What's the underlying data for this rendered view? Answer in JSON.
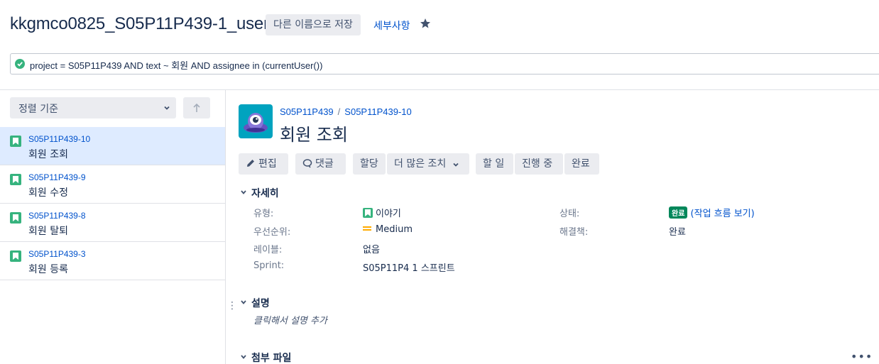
{
  "header": {
    "filter_title": "kkgmco0825_S05P11P439-1_user",
    "save_as_label": "다른 이름으로 저장",
    "details_label": "세부사항"
  },
  "jql": {
    "query": "project = S05P11P439 AND text ~ 회원 AND assignee in (currentUser())"
  },
  "sidebar": {
    "sort_label": "정렬 기준",
    "issues": [
      {
        "key": "S05P11P439-10",
        "summary": "회원 조회",
        "selected": true
      },
      {
        "key": "S05P11P439-9",
        "summary": "회원 수정",
        "selected": false
      },
      {
        "key": "S05P11P439-8",
        "summary": "회원 탈퇴",
        "selected": false
      },
      {
        "key": "S05P11P439-3",
        "summary": "회원 등록",
        "selected": false
      }
    ]
  },
  "issue": {
    "project_key": "S05P11P439",
    "issue_key": "S05P11P439-10",
    "title": "회원 조회",
    "toolbar": {
      "edit": "편집",
      "comment": "댓글",
      "assign": "할당",
      "more": "더 많은 조치",
      "todo": "할 일",
      "in_progress": "진행 중",
      "done": "완료"
    },
    "details": {
      "heading": "자세히",
      "type_label": "유형:",
      "type_value": "이야기",
      "priority_label": "우선순위:",
      "priority_value": "Medium",
      "labels_label": "레이블:",
      "labels_value": "없음",
      "sprint_label": "Sprint:",
      "sprint_value": "S05P11P4 1 스프린트",
      "status_label": "상태:",
      "status_value": "완료",
      "workflow_link": "(작업 흐름 보기)",
      "resolution_label": "해결책:",
      "resolution_value": "완료"
    },
    "description": {
      "heading": "설명",
      "placeholder": "클릭해서 설명 추가"
    },
    "attachments": {
      "heading": "첨부 파일"
    }
  },
  "colors": {
    "link": "#0052cc",
    "success": "#36b37e",
    "selected_bg": "#deebff",
    "status_done": "#00875a",
    "priority_medium": "#ffab00"
  }
}
